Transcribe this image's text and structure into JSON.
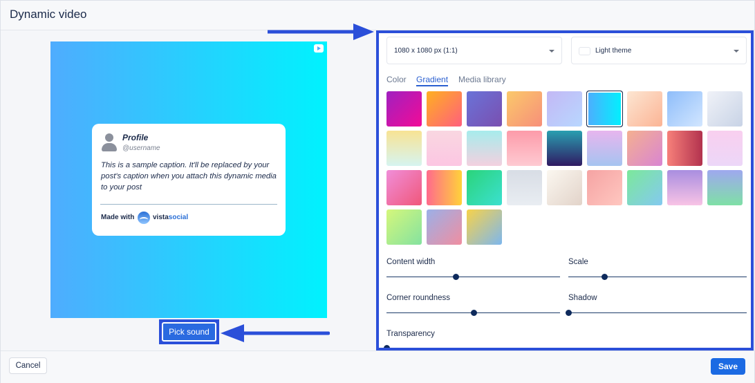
{
  "window": {
    "title": "Dynamic video"
  },
  "preview": {
    "profile_name": "Profile",
    "username": "@username",
    "caption": "This is a sample caption. It'll be replaced by your post's caption when you attach this dynamic media to your post",
    "made_with": "Made with",
    "brand_part1": "vista",
    "brand_part2": "social",
    "background_gradient": [
      "#4facfe",
      "#00f2fe"
    ]
  },
  "pick_sound": {
    "label": "Pick sound"
  },
  "panel": {
    "size_select": {
      "value": "1080 x 1080 px (1:1)"
    },
    "theme_select": {
      "value": "Light theme"
    },
    "tabs": [
      {
        "label": "Color",
        "active": false
      },
      {
        "label": "Gradient",
        "active": true
      },
      {
        "label": "Media library",
        "active": false
      }
    ],
    "gradients": [
      {
        "from": "#a020c0",
        "to": "#f20b97",
        "dir": "135deg",
        "selected": false
      },
      {
        "from": "#ffb020",
        "to": "#ff5f7e",
        "dir": "135deg",
        "selected": false
      },
      {
        "from": "#6a73d8",
        "to": "#7a4fb0",
        "dir": "135deg",
        "selected": false
      },
      {
        "from": "#fbc96a",
        "to": "#f78f7a",
        "dir": "135deg",
        "selected": false
      },
      {
        "from": "#c3b8f5",
        "to": "#b8d7ff",
        "dir": "135deg",
        "selected": false
      },
      {
        "from": "#4facfe",
        "to": "#00f2fe",
        "dir": "90deg",
        "selected": true
      },
      {
        "from": "#fde6d2",
        "to": "#fbb495",
        "dir": "135deg",
        "selected": false
      },
      {
        "from": "#8ebdfa",
        "to": "#d2e6ff",
        "dir": "135deg",
        "selected": false
      },
      {
        "from": "#f0f2f8",
        "to": "#c8d3e6",
        "dir": "135deg",
        "selected": false
      },
      {
        "from": "#f8e394",
        "to": "#d6f4f0",
        "dir": "180deg",
        "selected": false
      },
      {
        "from": "#f9d7e1",
        "to": "#fcc6e2",
        "dir": "180deg",
        "selected": false
      },
      {
        "from": "#a7ecec",
        "to": "#f3d0df",
        "dir": "180deg",
        "selected": false
      },
      {
        "from": "#fd9ba9",
        "to": "#fecad2",
        "dir": "180deg",
        "selected": false
      },
      {
        "from": "#2a9fb0",
        "to": "#2f1a63",
        "dir": "180deg",
        "selected": false
      },
      {
        "from": "#e7b5ee",
        "to": "#a6c4f0",
        "dir": "180deg",
        "selected": false
      },
      {
        "from": "#f4b090",
        "to": "#d985d2",
        "dir": "135deg",
        "selected": false
      },
      {
        "from": "#f7807a",
        "to": "#b2324e",
        "dir": "90deg",
        "selected": false
      },
      {
        "from": "#f9cfef",
        "to": "#ecd7f8",
        "dir": "180deg",
        "selected": false
      },
      {
        "from": "#f08ed9",
        "to": "#f0577a",
        "dir": "135deg",
        "selected": false
      },
      {
        "from": "#ff6a8d",
        "to": "#ffd23a",
        "dir": "90deg",
        "selected": false
      },
      {
        "from": "#2bd47a",
        "to": "#3be0d0",
        "dir": "135deg",
        "selected": false
      },
      {
        "from": "#d8dde5",
        "to": "#e9edf2",
        "dir": "180deg",
        "selected": false
      },
      {
        "from": "#fbf7f0",
        "to": "#e2d3c9",
        "dir": "135deg",
        "selected": false
      },
      {
        "from": "#f5a3a3",
        "to": "#ffc7c0",
        "dir": "135deg",
        "selected": false
      },
      {
        "from": "#7ce89a",
        "to": "#84c9f0",
        "dir": "135deg",
        "selected": false
      },
      {
        "from": "#a98ee0",
        "to": "#f8c3e5",
        "dir": "180deg",
        "selected": false
      },
      {
        "from": "#9fa8ef",
        "to": "#7fe0a6",
        "dir": "180deg",
        "selected": false
      },
      {
        "from": "#d5f77b",
        "to": "#84e2a0",
        "dir": "135deg",
        "selected": false
      },
      {
        "from": "#9bb0e8",
        "to": "#f08ea0",
        "dir": "135deg",
        "selected": false
      },
      {
        "from": "#f7d24a",
        "to": "#7db7ee",
        "dir": "135deg",
        "selected": false
      }
    ],
    "sliders": [
      {
        "label": "Content width",
        "value": 0.4
      },
      {
        "label": "Scale",
        "value": 0.2
      },
      {
        "label": "Corner roundness",
        "value": 0.5
      },
      {
        "label": "Shadow",
        "value": 0.0
      },
      {
        "label": "Transparency",
        "value": 0.0
      }
    ]
  },
  "footer": {
    "cancel_label": "Cancel",
    "save_label": "Save"
  }
}
